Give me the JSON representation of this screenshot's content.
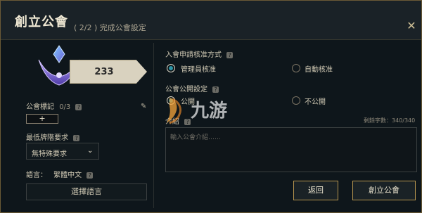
{
  "header": {
    "title": "創立公會",
    "subtitle": "( 2/2 ) 完成公會設定",
    "close_label": "✕"
  },
  "left": {
    "score": "233",
    "emblem_label": "公會標記",
    "emblem_count": "0/3",
    "add_symbol": "+",
    "min_rank_label": "最低牌階要求",
    "min_rank_selected": "無特殊要求",
    "language_label": "語言：",
    "language_value": "繁體中文",
    "select_language_button": "選擇語言"
  },
  "right": {
    "join_method_label": "入會申請核准方式",
    "join_option_admin": "管理員核准",
    "join_option_auto": "自動核准",
    "visibility_label": "公會公開設定",
    "visibility_public": "公開",
    "visibility_private": "不公開",
    "intro_label": "介紹",
    "char_count": "剩餘字數：340/340",
    "intro_placeholder": "輸入公會介紹……",
    "back_button": "返回",
    "create_button": "創立公會"
  },
  "watermark": {
    "text": "九游"
  },
  "icons": {
    "help": "question-icon",
    "pencil": "pencil-icon",
    "caret": "chevron-down-icon",
    "close": "close-icon"
  },
  "colors": {
    "accent": "#2b95a8",
    "gold": "#b7954e"
  }
}
